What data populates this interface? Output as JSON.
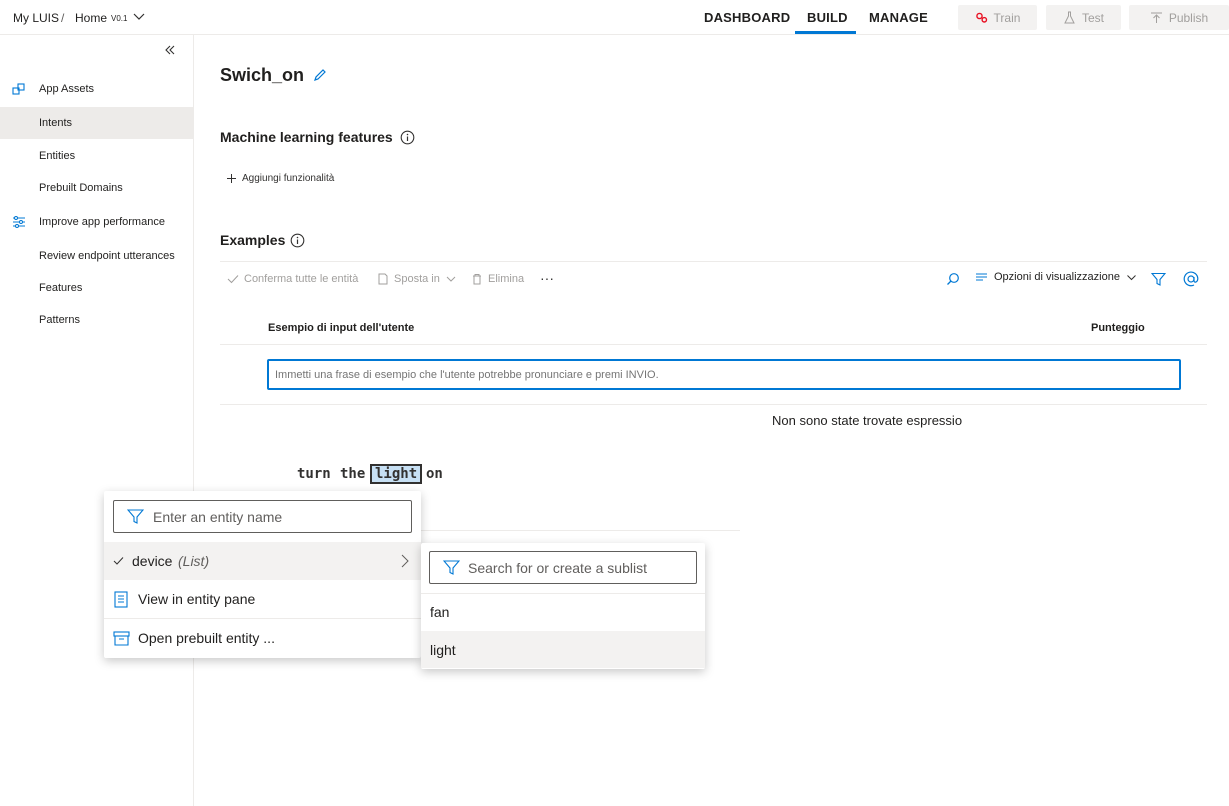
{
  "topbar": {
    "breadcrumb_app": "My LUIS",
    "breadcrumb_sep": "/",
    "breadcrumb_home": "Home",
    "version": "V0.1",
    "tabs": {
      "dashboard": "DASHBOARD",
      "build": "BUILD",
      "manage": "MANAGE"
    },
    "buttons": {
      "train": "Train",
      "test": "Test",
      "publish": "Publish"
    }
  },
  "sidebar": {
    "items": [
      {
        "label": "App Assets",
        "icon": "app-assets-icon"
      },
      {
        "label": "Intents"
      },
      {
        "label": "Entities"
      },
      {
        "label": "Prebuilt Domains"
      },
      {
        "label": "Improve app performance",
        "icon": "sliders-icon"
      },
      {
        "label": "Review endpoint utterances"
      },
      {
        "label": "Features"
      },
      {
        "label": "Patterns"
      }
    ],
    "active": "Intents"
  },
  "main": {
    "intent_name": "Swich_on",
    "ml_features_heading": "Machine learning features",
    "add_feature": "Aggiungi funzionalità",
    "examples_heading": "Examples",
    "toolbar": {
      "confirm_all": "Conferma tutte le entità",
      "move_to": "Sposta in",
      "delete": "Elimina",
      "more": "···",
      "view_options": "Opzioni di visualizzazione"
    },
    "columns": {
      "utterance": "Esempio di input dell'utente",
      "score": "Punteggio"
    },
    "utterance_placeholder": "Immetti una frase di esempio che l'utente potrebbe pronunciare e premi INVIO.",
    "no_results": "Non sono state trovate espressioni",
    "utterance_words": [
      "turn",
      "the",
      "light",
      "on"
    ]
  },
  "entity_menu": {
    "search_placeholder": "Enter an entity name",
    "selected_entity": "device",
    "selected_entity_type": "(List)",
    "view_in_pane": "View in entity pane",
    "open_prebuilt": "Open prebuilt entity ..."
  },
  "sublist_menu": {
    "search_placeholder": "Search for or create a sublist",
    "items": [
      "fan",
      "light"
    ]
  },
  "colors": {
    "accent": "#0078d4",
    "highlight": "#c7e0f4",
    "train_icon": "#e81123"
  }
}
